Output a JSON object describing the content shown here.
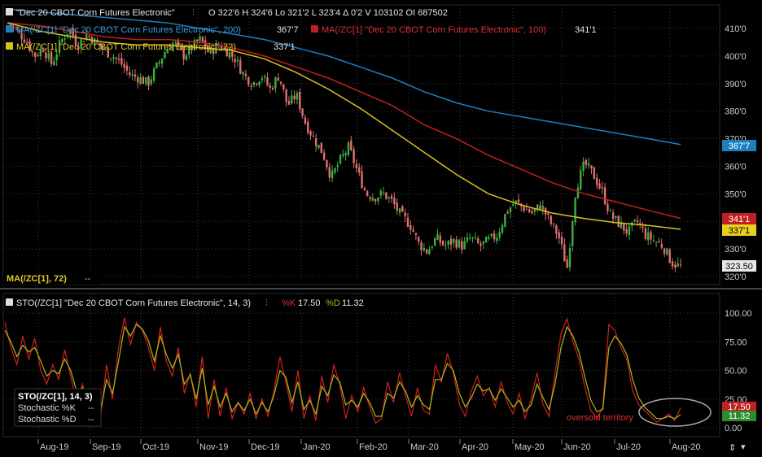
{
  "price_panel": {
    "header": {
      "symbol_label": "\"Dec 20 CBOT Corn Futures Electronic\"",
      "quote": "O 322'6  H 324'6  Lo 321'2  L 323'4  Δ 0'2  V 103102  OI 687502"
    },
    "ma200": {
      "label": "MA(/ZC[1] \"Dec 20 CBOT Corn Futures Electronic\", 200)",
      "value": "367'7",
      "color": "#1e7fc0"
    },
    "ma100": {
      "label": "MA(/ZC[1] \"Dec 20 CBOT Corn Futures Electronic\", 100)",
      "value": "341'1",
      "color": "#c02020"
    },
    "ma72": {
      "label": "MA(/ZC[1] \"Dec 20 CBOT Corn Futures Electronic\", 72)",
      "value": "337'1",
      "color": "#d8c020"
    },
    "last_price": "323.50",
    "study_box": {
      "label": "MA(/ZC[1], 72)",
      "value": "--"
    }
  },
  "sto_panel": {
    "header": {
      "label": "STO(/ZC[1] \"Dec 20 CBOT Corn Futures Electronic\", 14, 3)",
      "k_label": "%K",
      "k_value": "17.50",
      "d_label": "%D",
      "d_value": "11.32"
    },
    "study_box": {
      "title": "STO(/ZC[1], 14, 3)",
      "k_label": "Stochastic %K",
      "k_value": "--",
      "d_label": "Stochastic %D",
      "d_value": "--"
    },
    "annotation": "oversold territory",
    "k_badge": "17.50",
    "d_badge": "11.32"
  },
  "colors": {
    "up": "#3fae3f",
    "down": "#e07070",
    "k_line": "#d02020",
    "d_line": "#a8b81e",
    "grid": "#3a3a3a"
  },
  "chart_data": [
    {
      "type": "candlestick",
      "title": "\"Dec 20 CBOT Corn Futures Electronic\"",
      "y_ticks": [
        "320'0",
        "330'0",
        "340'0",
        "350'0",
        "360'0",
        "370'0",
        "380'0",
        "390'0",
        "400'0",
        "410'0"
      ],
      "y_tick_values": [
        320,
        330,
        340,
        350,
        360,
        370,
        380,
        390,
        400,
        410
      ],
      "ylim": [
        318,
        413
      ],
      "x_ticks": [
        "Aug-19",
        "Sep-19",
        "Oct-19",
        "Nov-19",
        "Dec-19",
        "Jan-20",
        "Feb-20",
        "Mar-20",
        "Apr-20",
        "May-20",
        "Jun-20",
        "Jul-20",
        "Aug-20"
      ],
      "close_path": [
        412,
        409,
        406,
        400,
        403,
        397,
        405,
        410,
        404,
        408,
        405,
        402,
        400,
        397,
        393,
        392,
        390,
        396,
        402,
        405,
        400,
        403,
        406,
        401,
        404,
        402,
        399,
        393,
        390,
        393,
        388,
        393,
        382,
        386,
        376,
        370,
        365,
        356,
        362,
        367,
        358,
        350,
        349,
        350,
        347,
        342,
        339,
        332,
        329,
        334,
        331,
        333,
        331,
        334,
        331,
        333,
        335,
        343,
        347,
        345,
        343,
        346,
        340,
        335,
        323,
        352,
        361,
        357,
        351,
        342,
        339,
        336,
        340,
        335,
        333,
        331,
        325,
        323.5
      ],
      "ma200": [
        417,
        416,
        415,
        414,
        413,
        412,
        410,
        408,
        406,
        403,
        400,
        396,
        392,
        387,
        383,
        380,
        378,
        376,
        374,
        372,
        370,
        367.9
      ],
      "ma100": [
        412,
        411,
        409,
        407,
        406,
        406,
        405,
        403,
        400,
        396,
        392,
        387,
        382,
        375,
        370,
        364,
        359,
        354,
        350,
        347,
        344,
        341.1
      ],
      "ma72": [
        412,
        409,
        407,
        405,
        404,
        404,
        403,
        402,
        399,
        394,
        388,
        381,
        373,
        365,
        357,
        350,
        346,
        343,
        341,
        339.5,
        338.5,
        337.1
      ],
      "last": 323.5
    },
    {
      "type": "line",
      "title": "STO(/ZC[1] \"Dec 20 CBOT Corn Futures Electronic\", 14, 3)",
      "y_ticks": [
        "0.00",
        "25.00",
        "50.00",
        "75.00",
        "100.00"
      ],
      "y_tick_values": [
        0,
        25,
        50,
        75,
        100
      ],
      "ylim": [
        0,
        100
      ],
      "series": [
        {
          "name": "%K",
          "values": [
            92,
            70,
            55,
            80,
            60,
            78,
            50,
            38,
            55,
            42,
            68,
            45,
            22,
            38,
            12,
            30,
            8,
            55,
            25,
            70,
            96,
            72,
            92,
            85,
            70,
            50,
            88,
            58,
            45,
            70,
            30,
            48,
            18,
            62,
            8,
            42,
            10,
            35,
            8,
            22,
            12,
            30,
            8,
            25,
            10,
            32,
            62,
            40,
            14,
            50,
            8,
            28,
            6,
            45,
            22,
            55,
            38,
            8,
            28,
            14,
            35,
            18,
            4,
            8,
            40,
            22,
            48,
            28,
            10,
            35,
            15,
            12,
            55,
            40,
            65,
            48,
            20,
            10,
            32,
            45,
            28,
            35,
            18,
            40,
            22,
            12,
            30,
            8,
            25,
            48,
            20,
            10,
            48,
            82,
            95,
            75,
            60,
            35,
            15,
            8,
            18,
            90,
            85,
            70,
            60,
            32,
            20,
            15,
            10,
            5,
            8,
            12,
            6,
            17.5
          ]
        },
        {
          "name": "%D",
          "values": [
            85,
            75,
            62,
            72,
            66,
            70,
            58,
            45,
            50,
            47,
            60,
            50,
            32,
            35,
            20,
            28,
            15,
            42,
            30,
            58,
            88,
            80,
            90,
            86,
            76,
            58,
            80,
            64,
            52,
            64,
            38,
            46,
            25,
            52,
            20,
            36,
            18,
            30,
            14,
            22,
            15,
            25,
            12,
            22,
            14,
            28,
            50,
            44,
            22,
            40,
            16,
            24,
            12,
            36,
            28,
            46,
            40,
            20,
            24,
            18,
            30,
            22,
            10,
            10,
            30,
            26,
            40,
            32,
            18,
            28,
            20,
            16,
            42,
            42,
            56,
            50,
            30,
            18,
            26,
            38,
            32,
            34,
            24,
            34,
            26,
            18,
            24,
            14,
            20,
            38,
            26,
            16,
            38,
            70,
            88,
            80,
            66,
            44,
            24,
            14,
            16,
            70,
            80,
            74,
            64,
            42,
            26,
            18,
            13,
            8,
            8,
            10,
            8,
            11.32
          ]
        }
      ]
    }
  ]
}
